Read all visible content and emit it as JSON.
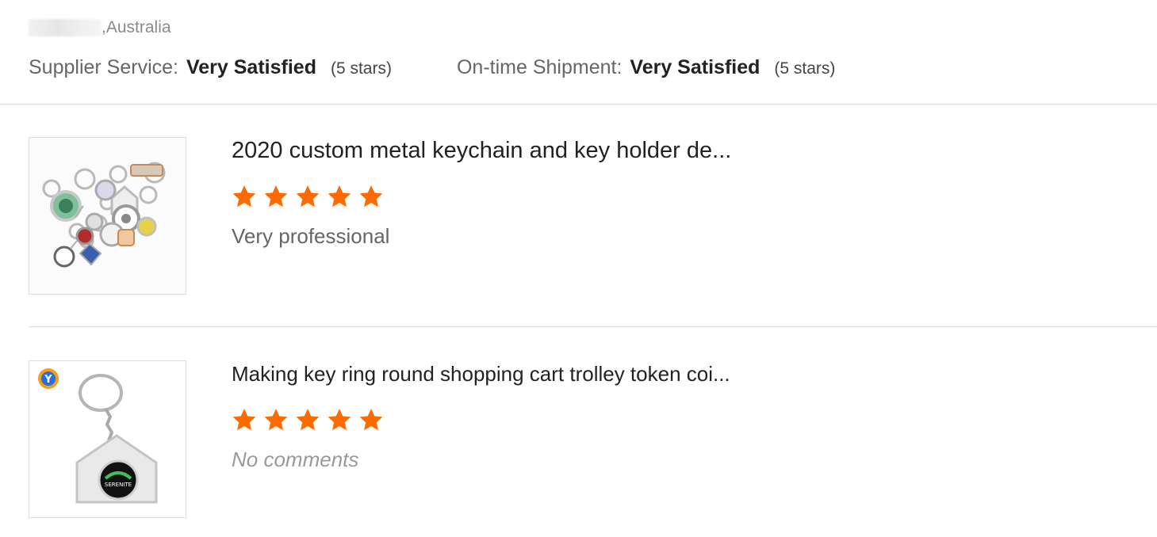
{
  "location": {
    "text": ",Australia"
  },
  "ratings": [
    {
      "label": "Supplier Service:",
      "value": "Very Satisfied",
      "stars_text": "(5 stars)"
    },
    {
      "label": "On-time Shipment:",
      "value": "Very Satisfied",
      "stars_text": "(5 stars)"
    }
  ],
  "colors": {
    "star": "#ff6a00",
    "divider": "#dcdcdc",
    "muted_text": "#999999"
  },
  "reviews": [
    {
      "title": "2020 custom metal keychain and key holder de...",
      "rating": 5,
      "comment": "Very professional",
      "thumb_icon": "keychains-product-image"
    },
    {
      "title": "Making key ring round shopping cart trolley token coi...",
      "rating": 5,
      "comment": "No comments",
      "thumb_icon": "trolley-token-keyring-product-image",
      "thumb_text": "SERENITE"
    }
  ]
}
